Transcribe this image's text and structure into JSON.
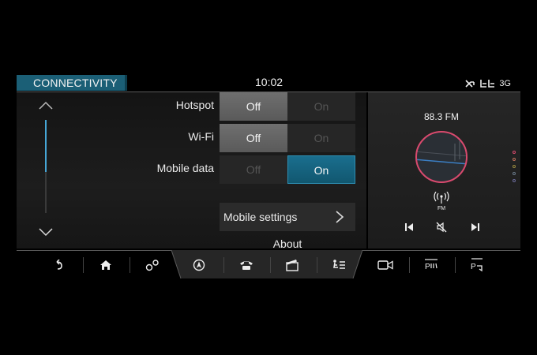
{
  "header": {
    "title": "CONNECTIVITY",
    "time": "10:02",
    "network": "3G"
  },
  "settings": {
    "hotspot": {
      "label": "Hotspot",
      "off": "Off",
      "on": "On",
      "state": "off"
    },
    "wifi": {
      "label": "Wi-Fi",
      "off": "Off",
      "on": "On",
      "state": "off"
    },
    "mobile_data": {
      "label": "Mobile data",
      "off": "Off",
      "on": "On",
      "state": "on"
    },
    "mobile_settings": "Mobile settings",
    "about": "About"
  },
  "media": {
    "station": "88.3 FM",
    "source_label": "FM"
  },
  "colors": {
    "accent": "#1b5f76",
    "active_on": "#11576f",
    "dial_ring": "#d94a6e",
    "scroll": "#46a6d6"
  },
  "bottom_nav": [
    "back-icon",
    "home-icon",
    "settings-icon",
    "navigation-icon",
    "phone-icon",
    "media-icon",
    "climate-icon",
    "camera-icon",
    "parking-icon",
    "vehicle-icon"
  ]
}
